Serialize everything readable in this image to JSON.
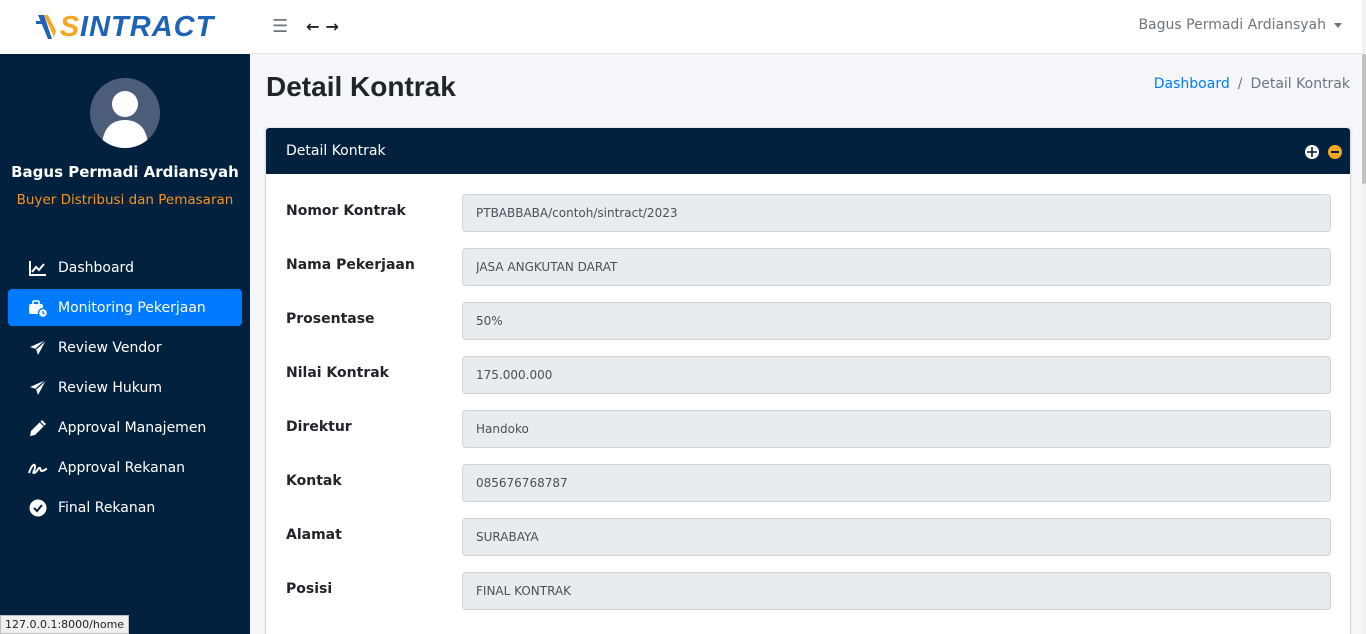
{
  "brand": {
    "text_accent": "S",
    "text_main": "INTRACT"
  },
  "navbar": {
    "user_name": "Bagus Permadi Ardiansyah"
  },
  "sidebar": {
    "user_name": "Bagus Permadi Ardiansyah",
    "user_role": "Buyer Distribusi dan Pemasaran",
    "items": [
      {
        "label": "Dashboard",
        "icon": "chart-line-icon"
      },
      {
        "label": "Monitoring Pekerjaan",
        "icon": "briefcase-clock-icon",
        "active": true
      },
      {
        "label": "Review Vendor",
        "icon": "paper-plane-icon"
      },
      {
        "label": "Review Hukum",
        "icon": "paper-plane-icon"
      },
      {
        "label": "Approval Manajemen",
        "icon": "pen-icon"
      },
      {
        "label": "Approval Rekanan",
        "icon": "signature-icon"
      },
      {
        "label": "Final Rekanan",
        "icon": "check-circle-icon"
      }
    ]
  },
  "page": {
    "title": "Detail Kontrak",
    "breadcrumb": {
      "home": "Dashboard",
      "separator": "/",
      "current": "Detail Kontrak"
    }
  },
  "card": {
    "title": "Detail Kontrak",
    "fields": [
      {
        "label": "Nomor Kontrak",
        "value": "PTBABBABA/contoh/sintract/2023"
      },
      {
        "label": "Nama Pekerjaan",
        "value": "JASA ANGKUTAN DARAT"
      },
      {
        "label": "Prosentase",
        "value": "50%"
      },
      {
        "label": "Nilai Kontrak",
        "value": "175.000.000"
      },
      {
        "label": "Direktur",
        "value": "Handoko"
      },
      {
        "label": "Kontak",
        "value": "085676768787"
      },
      {
        "label": "Alamat",
        "value": "SURABAYA"
      },
      {
        "label": "Posisi",
        "value": "FINAL KONTRAK"
      }
    ]
  },
  "statusbar": {
    "url": "127.0.0.1:8000/home"
  },
  "colors": {
    "sidebar_bg": "#02213f",
    "active_item": "#007bff",
    "role_text": "#f7941d",
    "brand_blue": "#1f63b6",
    "brand_orange": "#f5a623"
  }
}
